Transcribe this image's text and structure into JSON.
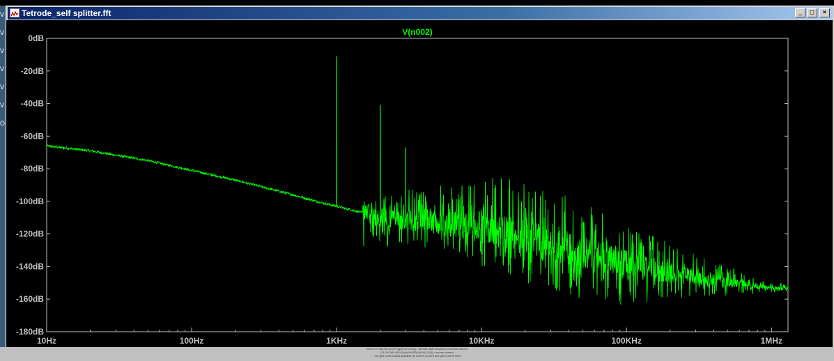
{
  "window": {
    "title": "Tetrode_self splitter.fft",
    "controls": {
      "minimize": "_",
      "maximize": "□",
      "close": "×"
    }
  },
  "background_left_strip": [
    "V",
    "V",
    "V",
    "V",
    "V",
    "V",
    "O"
  ],
  "status_lines": [
    "B.xxx n n VALUE={(K0*V(gaf)*(1-V(x0))} ; tetrode plate shaping for screen current",
    "G1 0 K VALUE={V(xx)*LIMIT(V(K,K),0,10)} ; screen current",
    "; mu grid current data available as screen current and grid current lines"
  ],
  "colors": {
    "background": "#000000",
    "trace": "#00ff00",
    "grid_axes": "#c0c0c0",
    "title": "#00ff00",
    "frame": "#d4d0c8"
  },
  "chart_data": {
    "type": "line",
    "title": "V(n002)",
    "xlabel": "",
    "ylabel": "",
    "x_scale": "log",
    "xlim": [
      10,
      1300000
    ],
    "ylim": [
      -180,
      0
    ],
    "x_ticks": [
      10,
      100,
      1000,
      10000,
      100000,
      1000000
    ],
    "x_tick_labels": [
      "10Hz",
      "100Hz",
      "1KHz",
      "10KHz",
      "100KHz",
      "1MHz"
    ],
    "y_ticks": [
      0,
      -20,
      -40,
      -60,
      -80,
      -100,
      -120,
      -140,
      -160,
      -180
    ],
    "y_tick_labels": [
      "0dB",
      "-20dB",
      "-40dB",
      "-60dB",
      "-80dB",
      "-100dB",
      "-120dB",
      "-140dB",
      "-160dB",
      "-180dB"
    ],
    "grid": false,
    "series": [
      {
        "name": "V(n002)",
        "color": "#00ff00",
        "noise_floor": [
          {
            "x": 10,
            "y": -66
          },
          {
            "x": 20,
            "y": -69
          },
          {
            "x": 50,
            "y": -75
          },
          {
            "x": 100,
            "y": -81
          },
          {
            "x": 200,
            "y": -87
          },
          {
            "x": 500,
            "y": -96
          },
          {
            "x": 800,
            "y": -101
          },
          {
            "x": 1000,
            "y": -103
          },
          {
            "x": 1500,
            "y": -107
          },
          {
            "x": 2000,
            "y": -110
          },
          {
            "x": 3000,
            "y": -112
          },
          {
            "x": 5000,
            "y": -113
          },
          {
            "x": 10000,
            "y": -116
          },
          {
            "x": 20000,
            "y": -122
          },
          {
            "x": 50000,
            "y": -131
          },
          {
            "x": 100000,
            "y": -138
          },
          {
            "x": 200000,
            "y": -144
          },
          {
            "x": 500000,
            "y": -150
          },
          {
            "x": 1000000,
            "y": -153
          },
          {
            "x": 1300000,
            "y": -154
          }
        ],
        "peaks": [
          {
            "x": 1000,
            "y": -11
          },
          {
            "x": 2000,
            "y": -41
          },
          {
            "x": 3000,
            "y": -67
          }
        ],
        "noise_envelope": [
          {
            "x": 1500,
            "top": -100,
            "bottom": -130
          },
          {
            "x": 5000,
            "top": -88,
            "bottom": -128
          },
          {
            "x": 10000,
            "top": -84,
            "bottom": -140
          },
          {
            "x": 20000,
            "top": -88,
            "bottom": -150
          },
          {
            "x": 50000,
            "top": -100,
            "bottom": -160
          },
          {
            "x": 100000,
            "top": -115,
            "bottom": -165
          },
          {
            "x": 200000,
            "top": -125,
            "bottom": -160
          },
          {
            "x": 500000,
            "top": -140,
            "bottom": -158
          },
          {
            "x": 1000000,
            "top": -150,
            "bottom": -156
          }
        ]
      }
    ]
  }
}
